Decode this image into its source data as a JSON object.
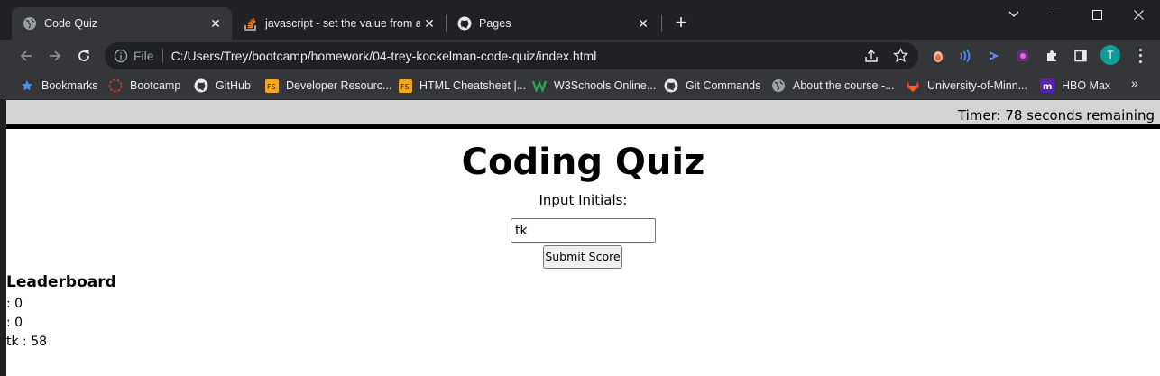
{
  "browser": {
    "tabs": [
      {
        "title": "Code Quiz",
        "icon": "globe-icon",
        "active": true
      },
      {
        "title": "javascript - set the value from an",
        "icon": "stackoverflow-icon",
        "active": false
      },
      {
        "title": "Pages",
        "icon": "github-icon",
        "active": false
      }
    ],
    "new_tab_glyph": "+",
    "address": {
      "scheme_label": "File",
      "url": "C:/Users/Trey/bootcamp/homework/04-trey-kockelman-code-quiz/index.html"
    },
    "profile_initial": "T",
    "bookmarks": [
      {
        "label": "Bookmarks",
        "icon": "star-icon"
      },
      {
        "label": "Bootcamp",
        "icon": "bootcamp-icon"
      },
      {
        "label": "GitHub",
        "icon": "github-icon"
      },
      {
        "label": "Developer Resourc...",
        "icon": "fs-icon"
      },
      {
        "label": "HTML Cheatsheet |...",
        "icon": "fs-icon"
      },
      {
        "label": "W3Schools Online...",
        "icon": "w3schools-icon"
      },
      {
        "label": "Git Commands",
        "icon": "github-icon"
      },
      {
        "label": "About the course -...",
        "icon": "globe-icon"
      },
      {
        "label": "University-of-Minn...",
        "icon": "gitlab-icon"
      },
      {
        "label": "HBO Max",
        "icon": "hbomax-icon"
      }
    ],
    "bookmarks_overflow": "»"
  },
  "page": {
    "timer_text": "Timer: 78 seconds remaining",
    "title": "Coding Quiz",
    "initials_label": "Input Initials:",
    "initials_value": "tk",
    "submit_label": "Submit Score",
    "leaderboard_title": "Leaderboard",
    "leaderboard": [
      ": 0",
      ": 0",
      "tk : 58"
    ]
  },
  "colors": {
    "tab_strip": "#202124",
    "toolbar": "#35363a",
    "timer_bar": "#d3d3d3",
    "profile": "#0f9d9a"
  }
}
